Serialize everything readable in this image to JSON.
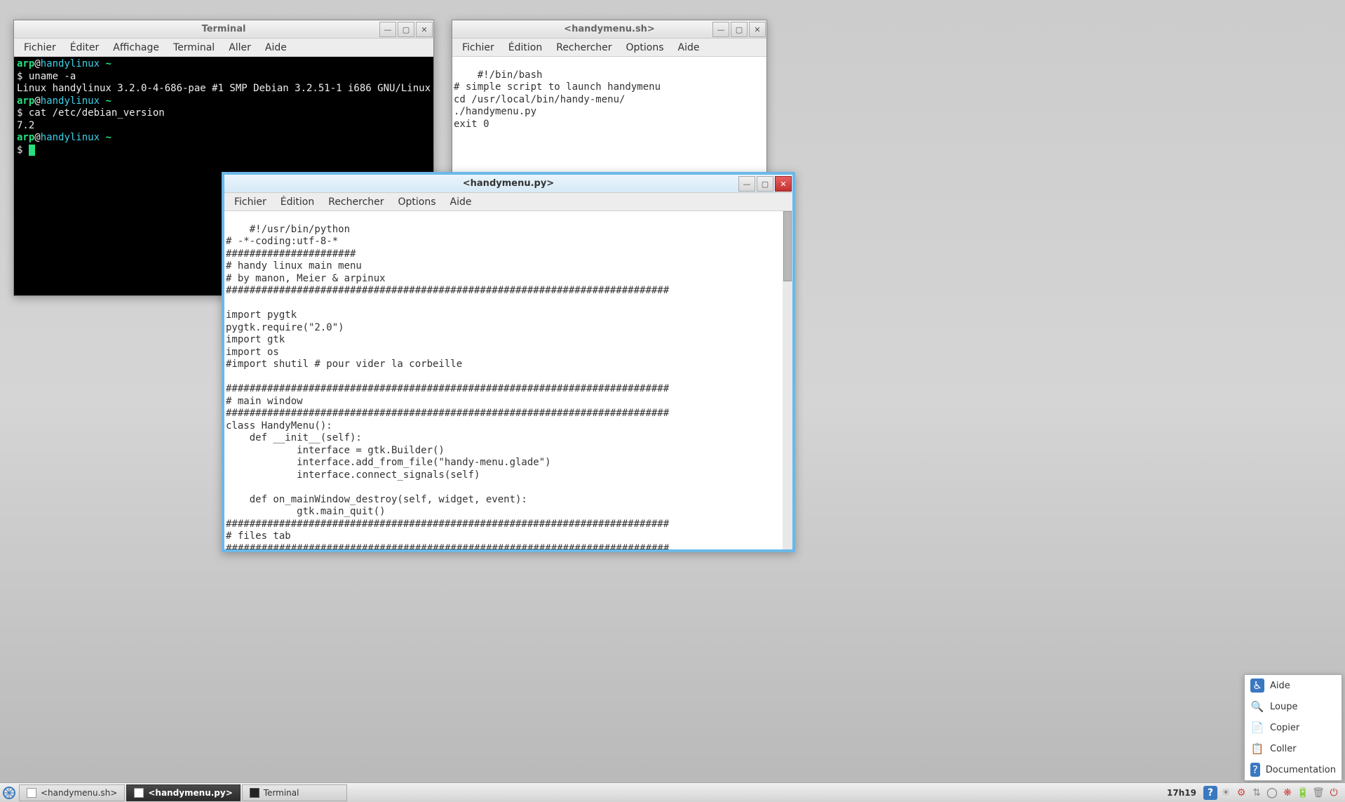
{
  "terminal": {
    "title": "Terminal",
    "menubar": [
      "Fichier",
      "Éditer",
      "Affichage",
      "Terminal",
      "Aller",
      "Aide"
    ],
    "prompt_user": "arp",
    "prompt_host": "handylinux",
    "prompt_path": "~",
    "lines": [
      {
        "type": "cmd",
        "cmd": "uname -a"
      },
      {
        "type": "out",
        "text": "Linux handylinux 3.2.0-4-686-pae #1 SMP Debian 3.2.51-1 i686 GNU/Linux"
      },
      {
        "type": "cmd",
        "cmd": "cat /etc/debian_version"
      },
      {
        "type": "out",
        "text": "7.2"
      },
      {
        "type": "cursor"
      }
    ]
  },
  "editor_sh": {
    "title": "<handymenu.sh>",
    "menubar": [
      "Fichier",
      "Édition",
      "Rechercher",
      "Options",
      "Aide"
    ],
    "content": "#!/bin/bash\n# simple script to launch handymenu\ncd /usr/local/bin/handy-menu/\n./handymenu.py\nexit 0"
  },
  "editor_py": {
    "title": "<handymenu.py>",
    "menubar": [
      "Fichier",
      "Édition",
      "Rechercher",
      "Options",
      "Aide"
    ],
    "content": "#!/usr/bin/python\n# -*-coding:utf-8-*\n######################\n# handy linux main menu\n# by manon, Meier & arpinux\n###########################################################################\n\nimport pygtk\npygtk.require(\"2.0\")\nimport gtk\nimport os\n#import shutil # pour vider la corbeille\n\n###########################################################################\n# main window\n###########################################################################\nclass HandyMenu():\n    def __init__(self):\n            interface = gtk.Builder()\n            interface.add_from_file(\"handy-menu.glade\")\n            interface.connect_signals(self)\n\n    def on_mainWindow_destroy(self, widget, event):\n            gtk.main_quit()\n###########################################################################\n# files tab\n###########################################################################\n    def on_mes_images_clicked(self, widget):\n            os.system(\"thunar $HOME/Images &\")\n            gtk.main_quit()\n\n    def on_mes_documents_clicked(self, widget):\n            os.system(\"thunar $HOME/Documents &\")\n            gtk.main_quit()"
  },
  "a11y_menu": {
    "items": [
      {
        "icon": "♿",
        "label": "Aide",
        "blue": true
      },
      {
        "icon": "🔍",
        "label": "Loupe",
        "blue": false
      },
      {
        "icon": "📄",
        "label": "Copier",
        "blue": false
      },
      {
        "icon": "📋",
        "label": "Coller",
        "blue": false
      },
      {
        "icon": "?",
        "label": "Documentation",
        "blue": true
      }
    ]
  },
  "taskbar": {
    "items": [
      {
        "label": "<handymenu.sh>",
        "icon": "doc",
        "active": false
      },
      {
        "label": "<handymenu.py>",
        "icon": "doc",
        "active": true
      },
      {
        "label": "Terminal",
        "icon": "term",
        "active": false
      }
    ],
    "clock": "17h19",
    "tray": [
      {
        "glyph": "?",
        "color": "#3a78c0",
        "bg": "#3a78c0",
        "name": "help-icon"
      },
      {
        "glyph": "☀",
        "color": "#888",
        "name": "brightness-icon"
      },
      {
        "glyph": "⚙",
        "color": "#c44",
        "name": "settings-icon"
      },
      {
        "glyph": "⇅",
        "color": "#888",
        "name": "network-icon"
      },
      {
        "glyph": "◯",
        "color": "#666",
        "name": "status-icon"
      },
      {
        "glyph": "❋",
        "color": "#c44",
        "name": "sparkle-icon"
      },
      {
        "glyph": "🔋",
        "color": "#666",
        "name": "battery-icon"
      },
      {
        "glyph": "🗑",
        "color": "#888",
        "name": "trash-icon"
      },
      {
        "glyph": "⏻",
        "color": "#c03030",
        "name": "power-icon"
      }
    ]
  },
  "win_controls": {
    "min": "—",
    "max": "▢",
    "close": "✕"
  }
}
